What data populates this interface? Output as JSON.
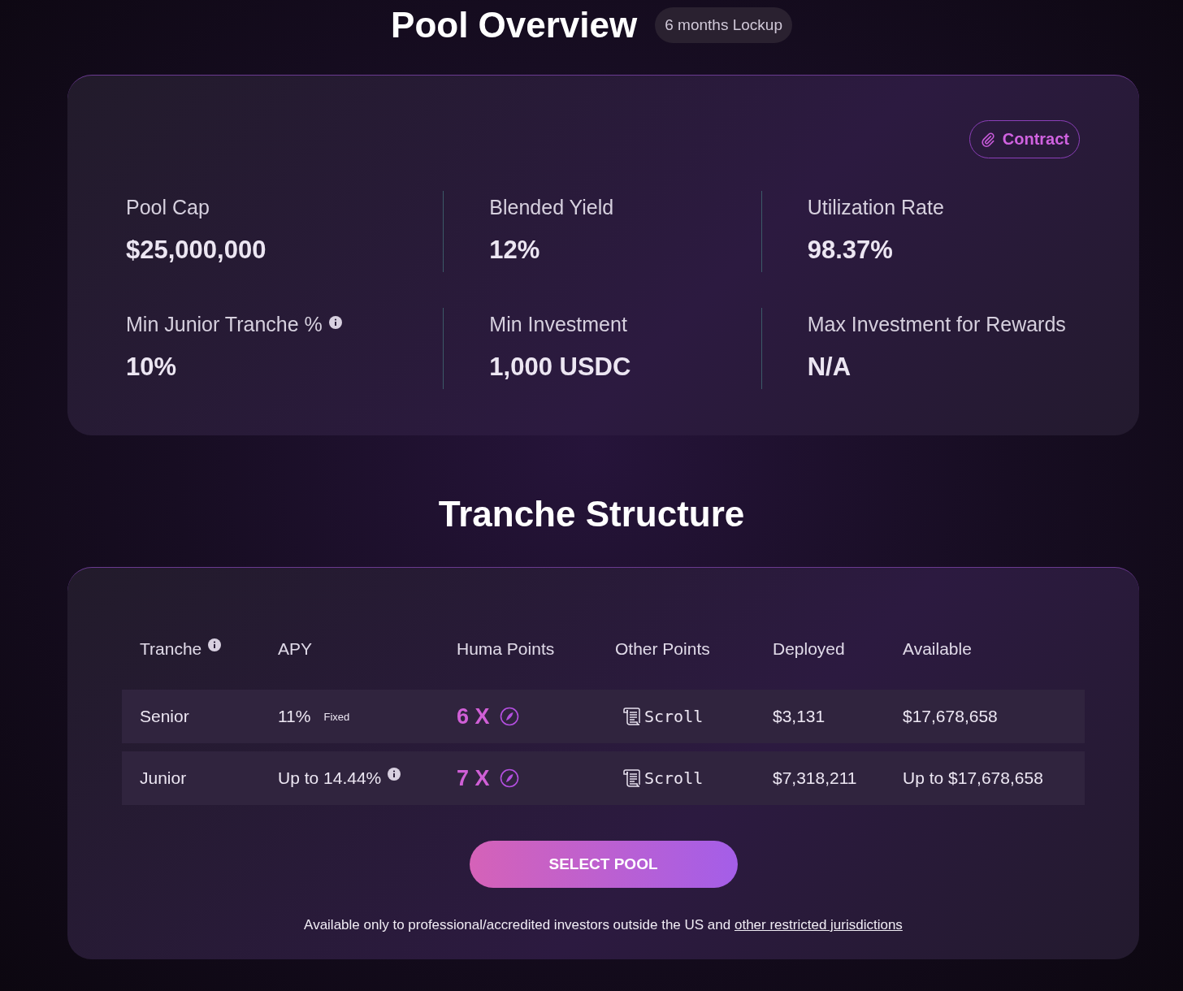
{
  "title": "Pool Overview",
  "lockup_badge": "6 months Lockup",
  "contract_button": "Contract",
  "stats": [
    {
      "label": "Pool Cap",
      "value": "$25,000,000",
      "info": false
    },
    {
      "label": "Blended Yield",
      "value": "12%",
      "info": false
    },
    {
      "label": "Utilization Rate",
      "value": "98.37%",
      "info": false
    },
    {
      "label": "Min Junior Tranche %",
      "value": "10%",
      "info": true
    },
    {
      "label": "Min Investment",
      "value": "1,000 USDC",
      "info": false
    },
    {
      "label": "Max Investment for Rewards",
      "value": "N/A",
      "info": false
    }
  ],
  "tranche_title": "Tranche Structure",
  "table": {
    "columns": [
      {
        "label": "Tranche",
        "info": true
      },
      {
        "label": "APY",
        "info": false
      },
      {
        "label": "Huma Points",
        "info": false
      },
      {
        "label": "Other Points",
        "info": false
      },
      {
        "label": "Deployed",
        "info": false
      },
      {
        "label": "Available",
        "info": false
      }
    ],
    "rows": [
      {
        "tranche": "Senior",
        "apy": "11%",
        "apy_tag": "Fixed",
        "apy_info": false,
        "huma_points": "6 X",
        "other_points": "Scroll",
        "deployed": "$3,131",
        "available": "$17,678,658"
      },
      {
        "tranche": "Junior",
        "apy": "Up to 14.44%",
        "apy_info": true,
        "huma_points": "7 X",
        "other_points": "Scroll",
        "deployed": "$7,318,211",
        "available": "Up to $17,678,658"
      }
    ]
  },
  "select_button": "SELECT POOL",
  "footnote": {
    "text": "Available only to professional/accredited investors outside the US and",
    "link": "other restricted jurisdictions"
  }
}
